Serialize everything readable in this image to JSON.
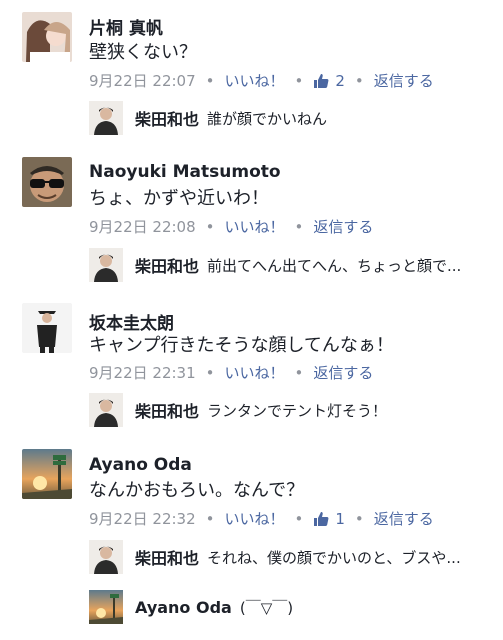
{
  "comments": [
    {
      "author": "片桐 真帆",
      "text": "壁狭くない？",
      "timestamp": "9月22日 22:07",
      "like_label": "いいね！",
      "like_count": "2",
      "reply_label": "返信する",
      "reply": {
        "author": "柴田和也",
        "text": "誰が顔でかいねん"
      }
    },
    {
      "author": "Naoyuki Matsumoto",
      "text": "ちょ、かずや近いわ！",
      "timestamp": "9月22日 22:08",
      "like_label": "いいね！",
      "reply_label": "返信する",
      "reply": {
        "author": "柴田和也",
        "text": "前出てへん出てへん、ちょっと顔で..."
      }
    },
    {
      "author": "坂本圭太朗",
      "text": "キャンプ行きたそうな顔してんなぁ！",
      "timestamp": "9月22日 22:31",
      "like_label": "いいね！",
      "reply_label": "返信する",
      "reply": {
        "author": "柴田和也",
        "text": "ランタンでテント灯そう！"
      }
    },
    {
      "author": "Ayano Oda",
      "text": "なんかおもろい。なんで？",
      "timestamp": "9月22日 22:32",
      "like_label": "いいね！",
      "like_count": "1",
      "reply_label": "返信する",
      "reply": {
        "author": "柴田和也",
        "text": "それね、僕の顔でかいのと、ブスや..."
      },
      "reply2": {
        "author": "Ayano Oda",
        "text": "(￣▽￣)"
      }
    }
  ],
  "colors": {
    "link": "#4b67a1",
    "meta": "#90949c",
    "text": "#1d2129"
  },
  "icons": {
    "like": "thumbs-up-icon"
  }
}
